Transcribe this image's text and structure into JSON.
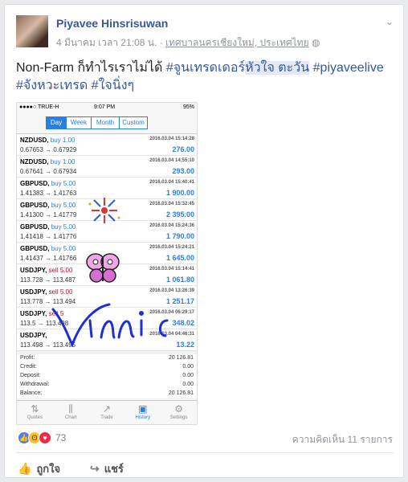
{
  "post": {
    "author": "Piyavee Hinsrisuwan",
    "date": "4 มีนาคม เวลา 21:08 น.",
    "location": "เทศบาลนครเชียงใหม่, ประเทศไทย",
    "caption_prefix": "Non-Farm ก็ทำไรเราไม่ได้ ",
    "tag1": "#จูนเทรดเดอร์",
    "tag1_highlight": "หัวใจ ตะวัน",
    "tag2": "#piyaveelive",
    "tag3": "#จังหวะเทรด",
    "tag4": "#ใจนิ่งๆ"
  },
  "phone": {
    "carrier": "●●●●○ TRUE-H",
    "time": "9:07 PM",
    "battery": "95%",
    "segments": [
      {
        "label": "Day",
        "active": true
      },
      {
        "label": "Week",
        "active": false
      },
      {
        "label": "Month",
        "active": false
      },
      {
        "label": "Custom",
        "active": false
      }
    ],
    "trades": [
      {
        "symbol": "NZDUSD,",
        "side": "buy 1.00",
        "dir": "buy",
        "date": "2016.03.04 15:14:28",
        "prices": "0.67653 → 0.67929",
        "pl": "276.00"
      },
      {
        "symbol": "NZDUSD,",
        "side": "buy 1.00",
        "dir": "buy",
        "date": "2016.03.04 14:55:10",
        "prices": "0.67641 → 0.67934",
        "pl": "293.00"
      },
      {
        "symbol": "GBPUSD,",
        "side": "buy 5.00",
        "dir": "buy",
        "date": "2016.03.04 15:40:41",
        "prices": "1.41383 → 1.41763",
        "pl": "1 900.00"
      },
      {
        "symbol": "GBPUSD,",
        "side": "buy 5.00",
        "dir": "buy",
        "date": "2016.03.04 15:32:45",
        "prices": "1.41300 → 1.41779",
        "pl": "2 395.00"
      },
      {
        "symbol": "GBPUSD,",
        "side": "buy 5.00",
        "dir": "buy",
        "date": "2016.03.04 15:24:36",
        "prices": "1.41418 → 1.41776",
        "pl": "1 790.00"
      },
      {
        "symbol": "GBPUSD,",
        "side": "buy 5.00",
        "dir": "buy",
        "date": "2016.03.04 15:24:21",
        "prices": "1.41437 → 1.41766",
        "pl": "1 645.00"
      },
      {
        "symbol": "USDJPY,",
        "side": "sell 5.00",
        "dir": "sell",
        "date": "2016.03.04 15:14:41",
        "prices": "113.728 → 113.487",
        "pl": "1 061.80"
      },
      {
        "symbol": "USDJPY,",
        "side": "sell 5.00",
        "dir": "sell",
        "date": "2016.03.04 13:26:39",
        "prices": "113.778 → 113.494",
        "pl": "1 251.17"
      },
      {
        "symbol": "USDJPY,",
        "side": "sell 5",
        "dir": "sell",
        "date": "2016.03.04 06:29:17",
        "prices": "113.5 → 113.498",
        "pl": "348.02"
      },
      {
        "symbol": "USDJPY,",
        "side": "",
        "dir": "sell",
        "date": "2016.03.04 04:46:31",
        "prices": "113.498 → 113.495",
        "pl": "13.22"
      }
    ],
    "summary": [
      {
        "label": "Profit:",
        "value": "20 126.81"
      },
      {
        "label": "Credit:",
        "value": "0.00"
      },
      {
        "label": "Deposit:",
        "value": "0.00"
      },
      {
        "label": "Withdrawal:",
        "value": "0.00"
      },
      {
        "label": "Balance:",
        "value": "20 126.81"
      }
    ],
    "tabs": [
      {
        "label": "Quotes",
        "icon": "quotes-icon",
        "glyph": "⇅",
        "active": false
      },
      {
        "label": "Chart",
        "icon": "chart-icon",
        "glyph": "⫼",
        "active": false
      },
      {
        "label": "Trade",
        "icon": "trade-icon",
        "glyph": "↗",
        "active": false
      },
      {
        "label": "History",
        "icon": "history-icon",
        "glyph": "▣",
        "active": true
      },
      {
        "label": "Settings",
        "icon": "settings-icon",
        "glyph": "⚙",
        "active": false
      }
    ],
    "signature": "Vinnie"
  },
  "footer": {
    "reaction_count": "73",
    "comments": "ความคิดเห็น 11 รายการ",
    "like_label": "ถูกใจ",
    "share_label": "แชร์"
  },
  "colors": {
    "link": "#365899",
    "accent": "#2a7de1",
    "sell": "#d0021b"
  }
}
